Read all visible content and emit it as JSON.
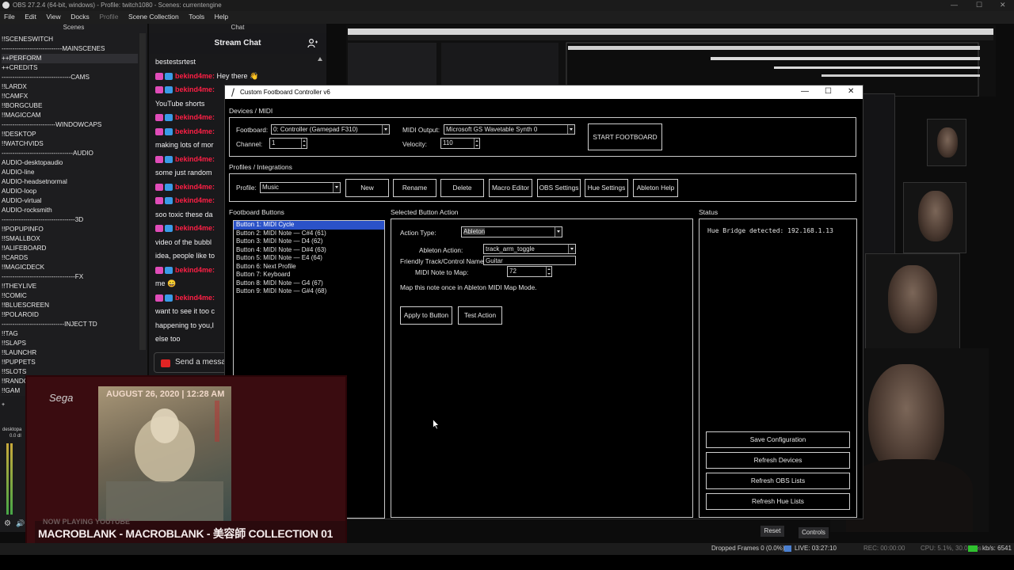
{
  "obs": {
    "title": "OBS 27.2.4 (64-bit, windows) - Profile: twitch1080 - Scenes: currentengine",
    "menu": [
      "File",
      "Edit",
      "View",
      "Docks",
      "Profile",
      "Scene Collection",
      "Tools",
      "Help"
    ]
  },
  "scenes": {
    "header": "Scenes",
    "items": [
      "!!SCENESWITCH",
      "----------------------------MAINSCENES",
      "++PERFORM",
      "++CREDITS",
      "--------------------------------CAMS",
      "!!LARDX",
      "!!CAMFX",
      "!!BORGCUBE",
      "!!MAGICCAM",
      "-------------------------WINDOWCAPS",
      "!!DESKTOP",
      "!!WATCHVIDS",
      "---------------------------------AUDIO",
      "AUDIO-desktopaudio",
      "AUDIO-line",
      "AUDIO-headsetnormal",
      "AUDIO-loop",
      "AUDIO-virtual",
      "AUDIO-rocksmith",
      "----------------------------------3D",
      "!!POPUPINFO",
      "!!SMALLBOX",
      "!!ALIFEBOARD",
      "!!CARDS",
      "!!MAGICDECK",
      "----------------------------------FX",
      "!!THEYLIVE",
      "!!COMIC",
      "!!BLUESCREEN",
      "!!POLAROID",
      "-----------------------------INJECT TD",
      "!!TAG",
      "!!SLAPS",
      "!!LAUNCHR",
      "!!PUPPETS",
      "!!SLOTS",
      "!!RANDOM",
      "!!GAM"
    ],
    "selected_index": 2
  },
  "chat": {
    "dock_header": "Chat",
    "title": "Stream Chat",
    "rows": [
      {
        "user": "",
        "text": "bestestsrtest"
      },
      {
        "user": "bekind4me:",
        "text": "Hey there 👋"
      },
      {
        "user": "bekind4me:",
        "text": ""
      },
      {
        "user": "",
        "text": "YouTube shorts"
      },
      {
        "user": "bekind4me:",
        "text": ""
      },
      {
        "user": "bekind4me:",
        "text": ""
      },
      {
        "user": "",
        "text": "making lots of mor"
      },
      {
        "user": "bekind4me:",
        "text": ""
      },
      {
        "user": "",
        "text": "some just random"
      },
      {
        "user": "bekind4me:",
        "text": ""
      },
      {
        "user": "bekind4me:",
        "text": ""
      },
      {
        "user": "",
        "text": "soo toxic these da"
      },
      {
        "user": "bekind4me:",
        "text": ""
      },
      {
        "user": "",
        "text": "video of the bubbl"
      },
      {
        "user": "",
        "text": "idea, people like to"
      },
      {
        "user": "bekind4me:",
        "text": ""
      },
      {
        "user": "",
        "text": "me 😄"
      },
      {
        "user": "bekind4me:",
        "text": ""
      },
      {
        "user": "",
        "text": "want to see it too c"
      },
      {
        "user": "",
        "text": "happening to you,I"
      },
      {
        "user": "",
        "text": "else too"
      }
    ],
    "send_placeholder": "Send a messa"
  },
  "footboard": {
    "window_title": "Custom Footboard Controller v6",
    "devices_label": "Devices / MIDI",
    "footboard_label": "Footboard:",
    "footboard_value": "0: Controller (Gamepad F310)",
    "channel_label": "Channel:",
    "channel_value": "1",
    "midi_output_label": "MIDI Output:",
    "midi_output_value": "Microsoft GS Wavetable Synth 0",
    "velocity_label": "Velocity:",
    "velocity_value": "110",
    "start_button": "START FOOTBOARD",
    "profiles_label": "Profiles / Integrations",
    "profile_label": "Profile:",
    "profile_value": "Music",
    "profile_buttons": [
      "New",
      "Rename",
      "Delete",
      "Macro Editor",
      "OBS Settings",
      "Hue Settings",
      "Ableton Help"
    ],
    "buttons_label": "Footboard Buttons",
    "buttons": [
      "Button 1: MIDI Cycle",
      "Button 2: MIDI Note — C#4 (61)",
      "Button 3: MIDI Note — D4 (62)",
      "Button 4: MIDI Note — D#4 (63)",
      "Button 5: MIDI Note — E4 (64)",
      "Button 6: Next Profile",
      "Button 7: Keyboard",
      "Button 8: MIDI Note — G4 (67)",
      "Button 9: MIDI Note — G#4 (68)"
    ],
    "selected_button_index": 0,
    "action_label": "Selected Button Action",
    "action_type_label": "Action Type:",
    "action_type_value": "Ableton",
    "ableton_action_label": "Ableton Action:",
    "ableton_action_value": "track_arm_toggle",
    "friendly_name_label": "Friendly Track/Control Name:",
    "friendly_name_value": "Guitar",
    "midi_note_label": "MIDI Note to Map:",
    "midi_note_value": "72",
    "hint": "Map this note once in Ableton MIDI Map Mode.",
    "apply_button": "Apply to Button",
    "test_button": "Test Action",
    "status_label": "Status",
    "status_text": "Hue Bridge detected: 192.168.1.13",
    "status_buttons": [
      "Save Configuration",
      "Refresh Devices",
      "Refresh OBS Lists",
      "Refresh Hue Lists"
    ]
  },
  "album": {
    "logo": "Sega",
    "date": "AUGUST 26, 2020  |  12:28 AM",
    "now_playing": "NOW PLAYING YOUTUBE",
    "track": "MACROBLANK - MACROBLANK - 美容師 COLLECTION 01"
  },
  "mixer": {
    "desktop_label": "desktopa",
    "desktop_level": "0.0 dl"
  },
  "controls": {
    "reset": "Reset",
    "controls": "Controls"
  },
  "status_bar": {
    "dropped": "Dropped Frames 0 (0.0%)",
    "live": "LIVE: 03:27:10",
    "rec": "REC: 00:00:00",
    "cpu": "CPU: 5.1%, 30.00 fps",
    "kbps": "kb/s: 6541"
  }
}
